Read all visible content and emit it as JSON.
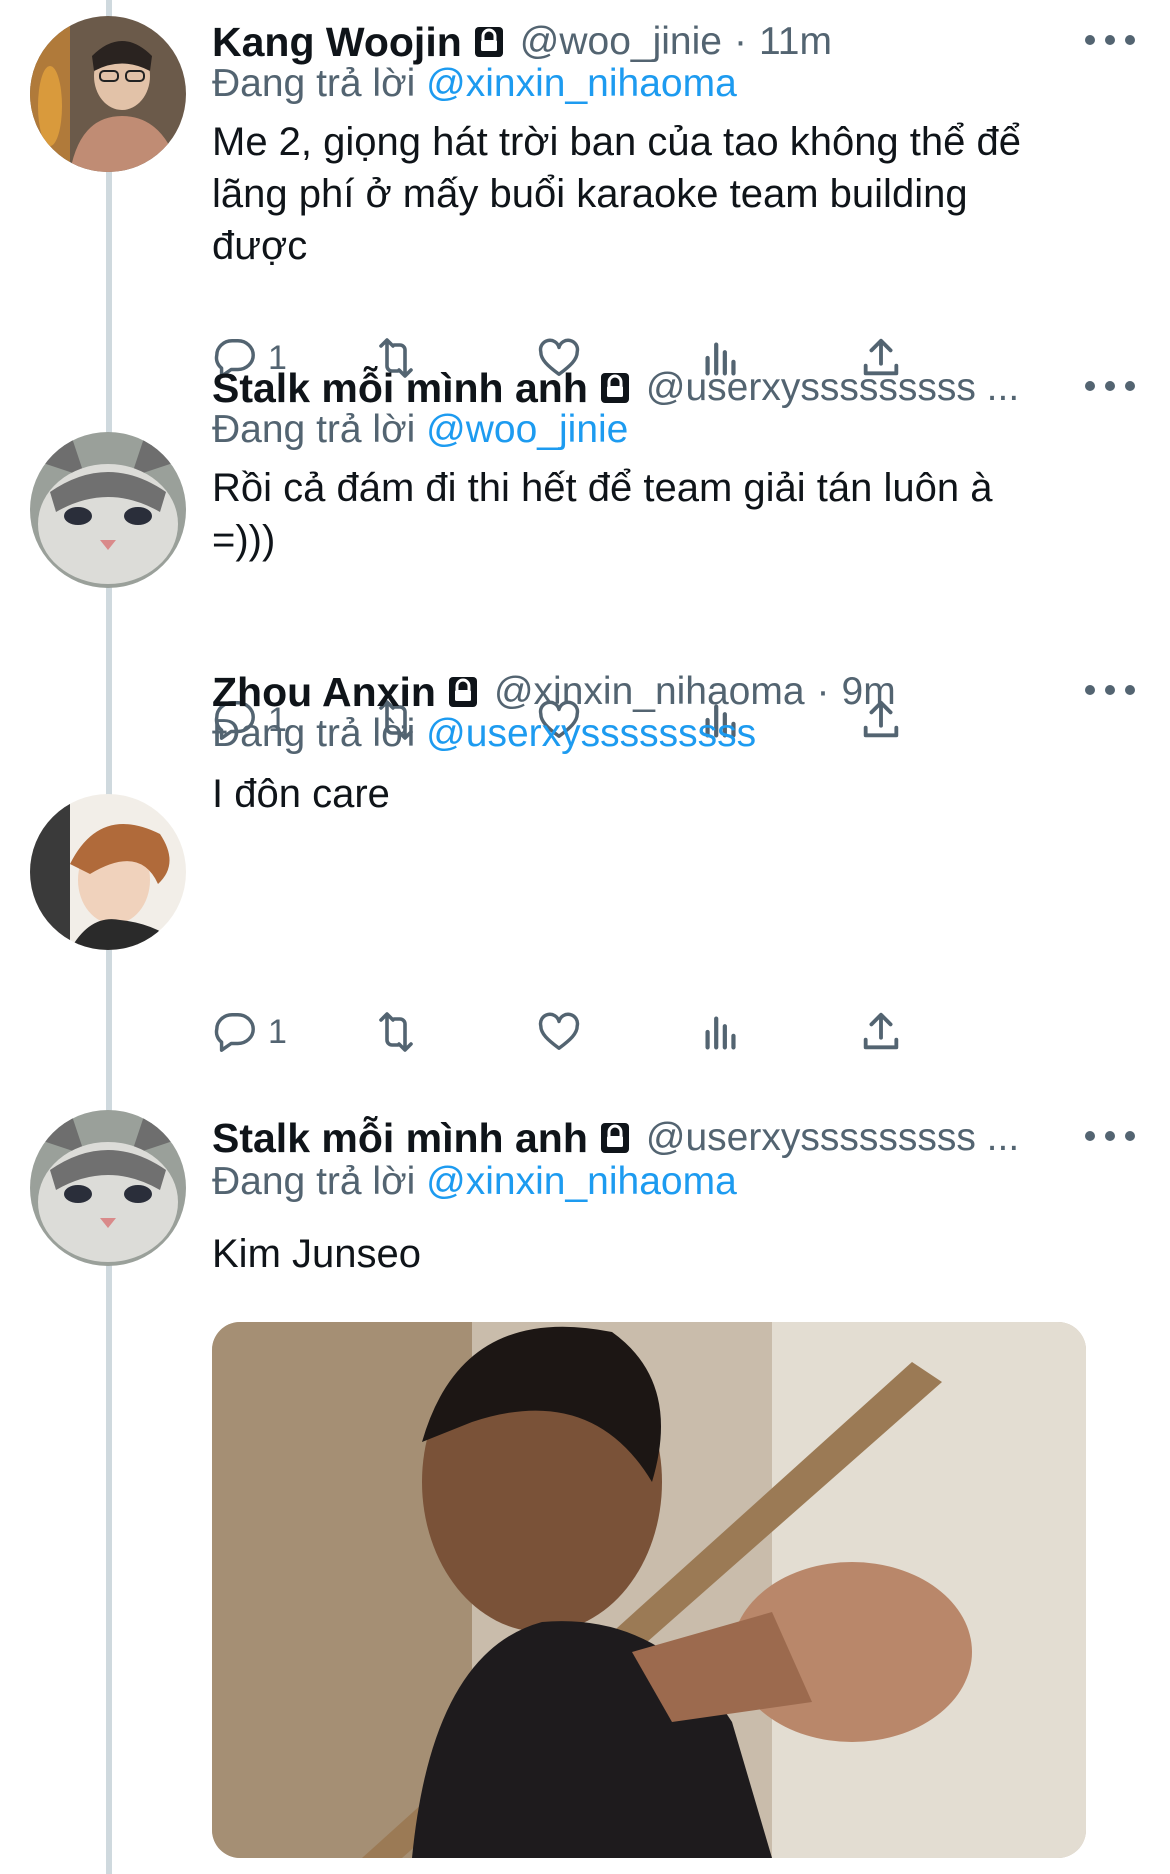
{
  "tweets": [
    {
      "name": "Kang Woojin",
      "handle": "@woo_jinie",
      "time_sep": "·",
      "time": "11m",
      "reply_prefix": "Đang trả lời",
      "reply_to": "@xinxin_nihaoma",
      "lines": [
        "Me 2, giọng hát trời ban của tao không thể để",
        "lãng phí ở mấy buổi karaoke team building",
        "được"
      ],
      "reply_count": "1"
    },
    {
      "name": "Stalk mỗi mình anh",
      "handle": "@userxysssssssss ...",
      "reply_prefix": "Đang trả lời",
      "reply_to": "@woo_jinie",
      "lines": [
        "Rồi cả đám đi thi hết để team giải tán luôn à",
        "=)))"
      ],
      "reply_count": "1"
    },
    {
      "name": "Zhou Anxin",
      "handle": "@xinxin_nihaoma",
      "time_sep": "·",
      "time": "9m",
      "reply_prefix": "Đang trả lời",
      "reply_to": "@userxysssssssss",
      "lines": [
        "I đôn care"
      ],
      "reply_count": "1"
    },
    {
      "name": "Stalk mỗi mình anh",
      "handle": "@userxysssssssss ...",
      "reply_prefix": "Đang trả lời",
      "reply_to": "@xinxin_nihaoma",
      "lines": [
        "Kim Junseo"
      ]
    }
  ],
  "colors": {
    "text": "#0f1419",
    "secondary": "#536471",
    "link": "#1d9bf0",
    "thread_line": "#cfd9de"
  },
  "icons": [
    "lock-icon",
    "more-icon",
    "reply-icon",
    "retweet-icon",
    "like-icon",
    "views-icon",
    "share-icon"
  ]
}
